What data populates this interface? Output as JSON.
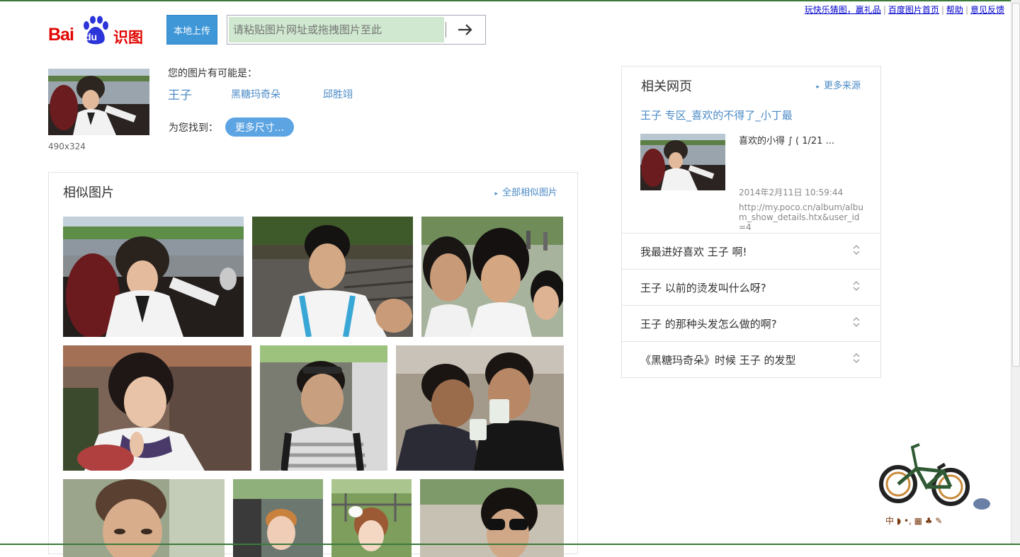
{
  "top_links": [
    "玩快乐猜图，赢礼品",
    "百度图片首页",
    "帮助",
    "意见反馈"
  ],
  "logo": {
    "bai": "Bai",
    "du": "du",
    "shitu": "识图"
  },
  "search": {
    "upload_label": "本地上传",
    "placeholder": "请粘贴图片网址或拖拽图片至此"
  },
  "query_image": {
    "size": "490x324"
  },
  "guesses": {
    "title": "您的图片有可能是：",
    "items": [
      "王子",
      "黑糖玛奇朵",
      "邱胜翊"
    ]
  },
  "found": {
    "label": "为您找到：",
    "more_sizes": "更多尺寸..."
  },
  "similar": {
    "title": "相似图片",
    "all_link": "全部相似图片"
  },
  "related": {
    "title": "相关网页",
    "more_link": "更多来源",
    "result": {
      "link": "王子 专区_喜欢的不得了_小丁最",
      "desc": "喜欢的小得 ∫ ( 1/21 ...",
      "date": "2014年2月11日 10:59:44",
      "url": "http://my.poco.cn/album/album_show_details.htx&user_id=4"
    },
    "questions": [
      "我最进好喜欢 王子 啊!",
      "王子 以前的烫发叫什么呀?",
      "王子 的那种头发怎么做的啊?",
      "《黑糖玛奇朵》时候 王子 的发型"
    ]
  },
  "decor": {
    "bike_caption": "中 ◗ •, ▦ ♣ ✎"
  }
}
